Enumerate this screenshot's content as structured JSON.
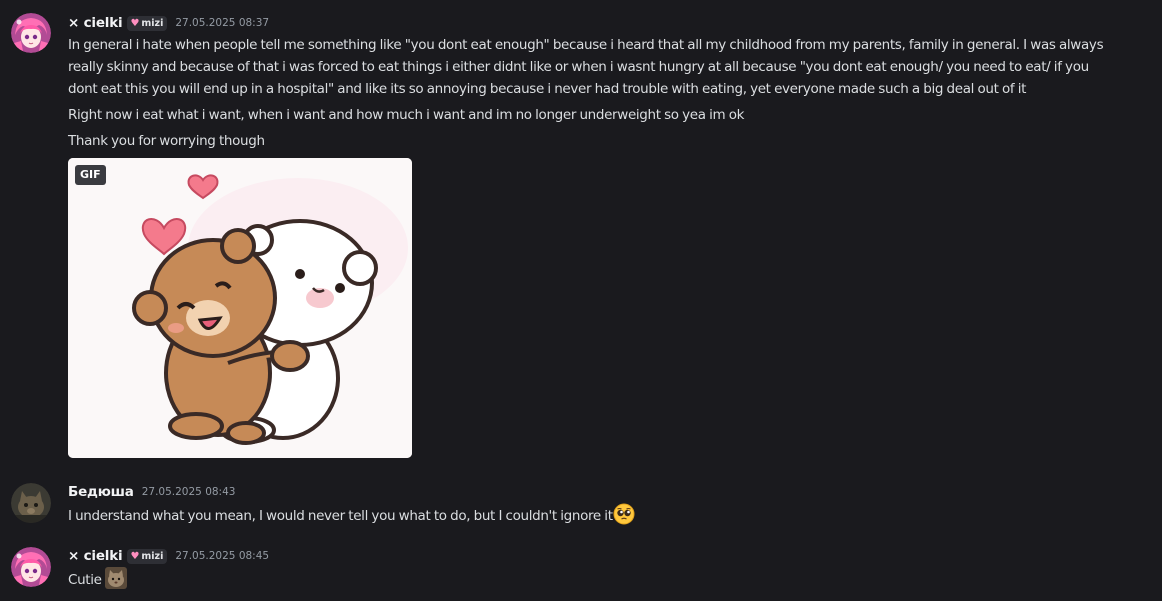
{
  "messages": [
    {
      "author": "× cielki",
      "clan_tag": "mizi",
      "timestamp": "27.05.2025 08:37",
      "avatar": "pink-hair-anime-avatar",
      "lines": [
        "In general i hate when people tell me something like \"you dont eat enough\" because i heard that all my childhood from my parents, family in general. I was always",
        "really skinny and because of that i was forced to eat things i either didnt like or when i wasnt hungry at all because \"you dont eat enough/ you need to eat/ if you",
        "dont eat this you will end up in a hospital\" and like its so annoying because i never had trouble with eating, yet everyone made such a big deal out of it",
        "Right now i eat what i want, when i want and how much i want and im no longer underweight so yea im ok",
        "Thank you for worrying though"
      ],
      "attachment": {
        "badge": "GIF",
        "description": "two bears hugging"
      }
    },
    {
      "author": "Бедюша",
      "timestamp": "27.05.2025 08:43",
      "avatar": "cat-photo-avatar",
      "text": "I understand what you mean, I would never tell you what to do, but I couldn't ignore it",
      "trailing_emoji": "pleading-face-emoji"
    },
    {
      "author": "× cielki",
      "clan_tag": "mizi",
      "timestamp": "27.05.2025 08:45",
      "avatar": "pink-hair-anime-avatar",
      "text": "Cutie",
      "trailing_emoji": "cat-emoji"
    }
  ],
  "colors": {
    "background": "#1a1a1e",
    "text": "#dbdee1",
    "username": "#f2f3f5",
    "timestamp": "#949ba4",
    "clan_heart": "#ff8fc0"
  }
}
